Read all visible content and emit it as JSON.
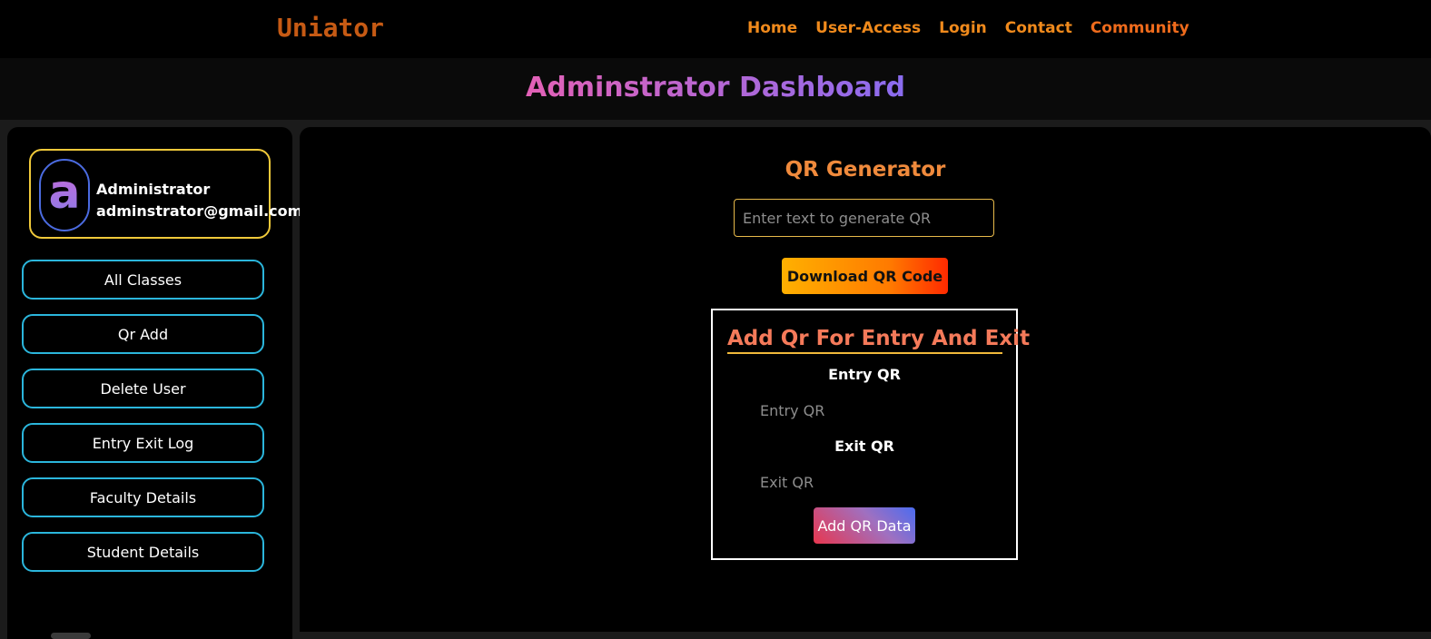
{
  "navbar": {
    "brand": "Uniator",
    "links": [
      "Home",
      "User-Access",
      "Login",
      "Contact",
      "Community"
    ]
  },
  "header": {
    "title": "Adminstrator Dashboard"
  },
  "sidebar": {
    "profile": {
      "avatar_letter": "a",
      "name": "Administrator",
      "email": "adminstrator@gmail.com"
    },
    "buttons": [
      "All Classes",
      "Qr Add",
      "Delete User",
      "Entry Exit Log",
      "Faculty Details",
      "Student Details"
    ]
  },
  "main": {
    "qr_generator": {
      "title": "QR Generator",
      "input_placeholder": "Enter text to generate QR",
      "download_label": "Download QR Code"
    },
    "entry_exit": {
      "title": "Add Qr For Entry And Exit",
      "entry_label": "Entry QR",
      "entry_placeholder": "Entry QR",
      "exit_label": "Exit QR",
      "exit_placeholder": "Exit QR",
      "submit_label": "Add QR Data"
    }
  },
  "colors": {
    "brand": "#c65a14",
    "nav_link": "#f08a1c",
    "sidebar_border": "#2bb6dc",
    "profile_border": "#f0c93a"
  },
  "icons": [
    "avatar-letter"
  ]
}
